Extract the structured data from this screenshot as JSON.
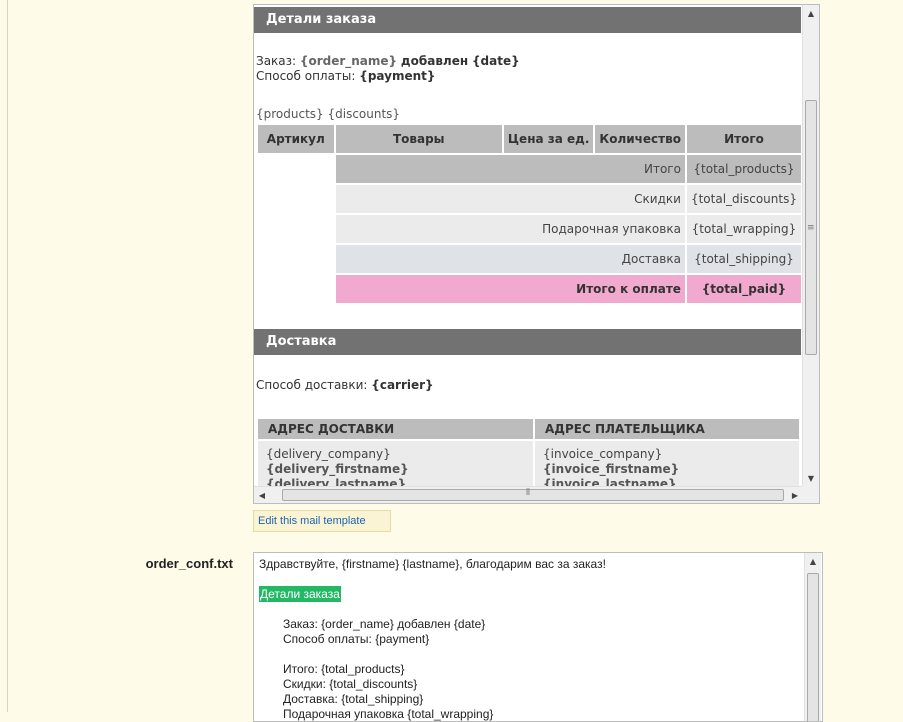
{
  "html_preview": {
    "order_header": "Детали заказа",
    "order_prefix": "Заказ:",
    "order_name_tag": "{order_name}",
    "added_word": "добавлен",
    "date_tag": "{date}",
    "payment_prefix": "Способ оплаты:",
    "payment_tag": "{payment}",
    "products_line": "{products} {discounts}",
    "columns": [
      "Артикул",
      "Товары",
      "Цена за ед.",
      "Количество",
      "Итого"
    ],
    "totals": [
      {
        "label": "Итого",
        "value": "{total_products}"
      },
      {
        "label": "Скидки",
        "value": "{total_discounts}"
      },
      {
        "label": "Подарочная упаковка",
        "value": "{total_wrapping}"
      },
      {
        "label": "Доставка",
        "value": "{total_shipping}"
      },
      {
        "label": "Итого к оплате",
        "value": "{total_paid}"
      }
    ],
    "shipping_header": "Доставка",
    "carrier_prefix": "Способ доставки:",
    "carrier_tag": "{carrier}",
    "delivery_address_header": "АДРЕС ДОСТАВКИ",
    "invoice_address_header": "АДРЕС ПЛАТЕЛЬЩИКА",
    "delivery_lines": [
      "{delivery_company}",
      "{delivery_firstname}",
      "{delivery_lastname}"
    ],
    "invoice_lines": [
      "{invoice_company}",
      "{invoice_firstname}",
      "{invoice_lastname}"
    ]
  },
  "edit_link": "Edit this mail template",
  "txt_template": {
    "filename": "order_conf.txt",
    "greeting": "Здравствуйте, {firstname} {lastname}, благодарим вас за заказ!",
    "highlighted_header": "Детали заказа",
    "order_line": "Заказ: {order_name} добавлен {date}",
    "payment_line": "Способ оплаты: {payment}",
    "total_line": "Итого: {total_products}",
    "discount_line": "Скидки: {total_discounts}",
    "shipping_line": "Доставка: {total_shipping}",
    "wrapping_line": "Подарочная упаковка {total_wrapping}"
  },
  "colors": {
    "page_bg": "#fffbe9",
    "section_header": "#727272",
    "total_paid_row": "#f2a9cf",
    "highlight": "#23b864",
    "link": "#1b64b0"
  }
}
